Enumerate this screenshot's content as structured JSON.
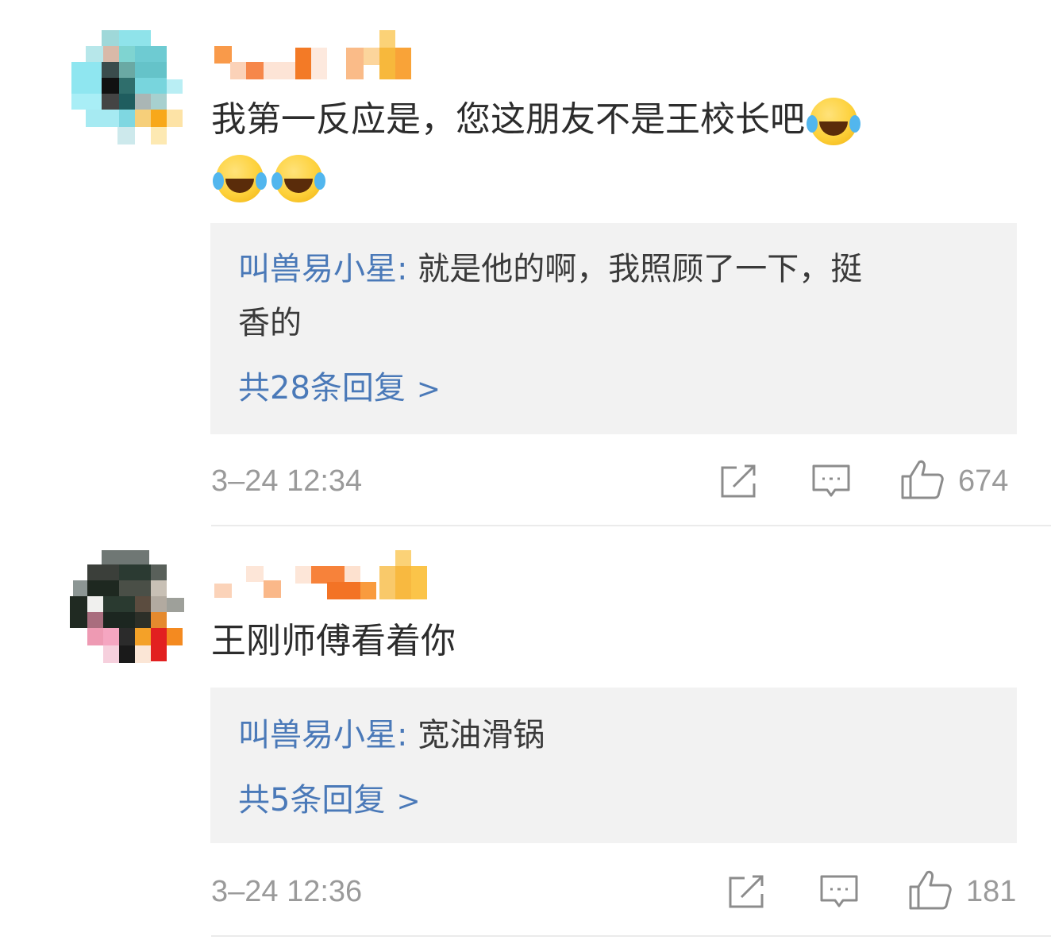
{
  "comments": [
    {
      "text": "我第一反应是，您这朋友不是王校长吧",
      "reply": {
        "author": "叫兽易小星:",
        "text_line1": " 就是他的啊，我照顾了一下，挺",
        "text_line2": "香的"
      },
      "reply_count_label": "共28条回复",
      "chevron": ">",
      "time": "3–24 12:34",
      "likes": "674"
    },
    {
      "text": "王刚师傅看着你",
      "reply": {
        "author": "叫兽易小星:",
        "text_line1": " 宽油滑锅"
      },
      "reply_count_label": "共5条回复",
      "chevron": ">",
      "time": "3–24 12:36",
      "likes": "181"
    }
  ],
  "icons": {
    "emoji": "laughing-crying-emoji",
    "share": "share-icon",
    "comment": "comment-icon",
    "like": "thumbs-up-icon"
  },
  "colors": {
    "link": "#4a79b8",
    "meta": "#9a9a9a",
    "reply_bg": "#f2f2f2"
  }
}
